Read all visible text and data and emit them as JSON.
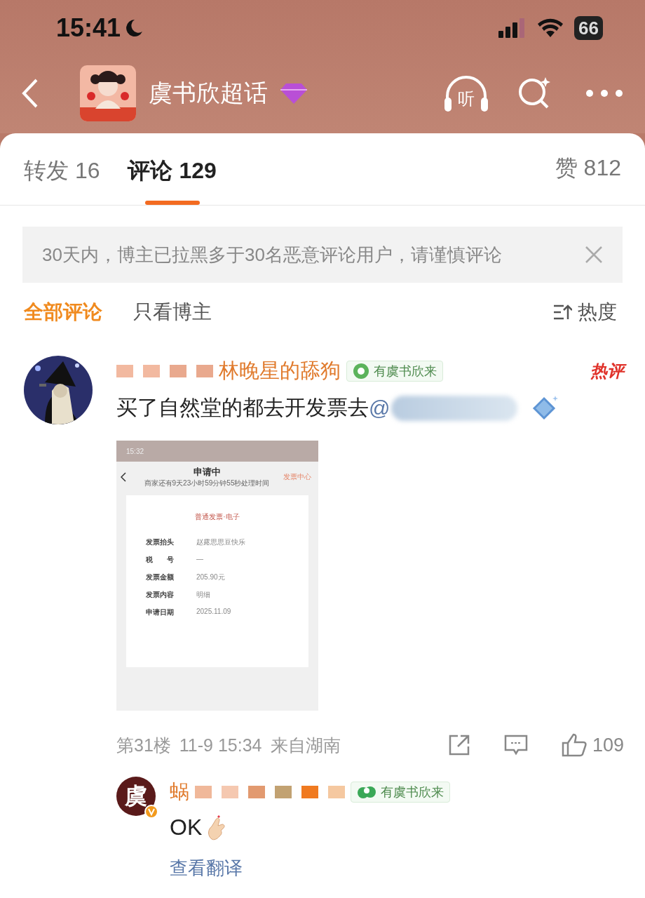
{
  "status_bar": {
    "time": "15:41",
    "battery": "66"
  },
  "header": {
    "title": "虞书欣超话",
    "listen_label": "听"
  },
  "tabs": [
    {
      "label": "转发",
      "count": "16",
      "selected": false
    },
    {
      "label": "评论",
      "count": "129",
      "selected": true
    }
  ],
  "likes": {
    "label": "赞",
    "count": "812"
  },
  "notice": {
    "text": "30天内，博主已拉黑多于30名恶意评论用户，请谨慎评论"
  },
  "filters": [
    {
      "label": "全部评论",
      "selected": true
    },
    {
      "label": "只看博主",
      "selected": false
    }
  ],
  "sort": {
    "label": "热度"
  },
  "comment": {
    "author": "林晚星的舔狗",
    "badge": "有虞书欣来",
    "hot_label": "热评",
    "text": "买了自然堂的都去开发票去",
    "mention": "@",
    "screenshot": {
      "time": "15:32",
      "title": "申请中",
      "subtitle": "商家还有9天23小时59分钟55秒处理时间",
      "link": "发票中心",
      "invoice_type": "普通发票·电子",
      "fields": [
        {
          "label": "发票抬头",
          "value": "赵露思思豆快乐"
        },
        {
          "label": "税　　号",
          "value": "—"
        },
        {
          "label": "发票金额",
          "value": "205.90元"
        },
        {
          "label": "发票内容",
          "value": "明细"
        },
        {
          "label": "申请日期",
          "value": "2025.11.09"
        }
      ]
    },
    "floor": "第31楼",
    "date": "11-9 15:34",
    "location": "来自湖南",
    "like_count": "109",
    "reply": {
      "avatar_text": "虞",
      "author": "蜗",
      "badge": "有虞书欣来",
      "text": "OK",
      "translate": "查看翻译"
    }
  }
}
